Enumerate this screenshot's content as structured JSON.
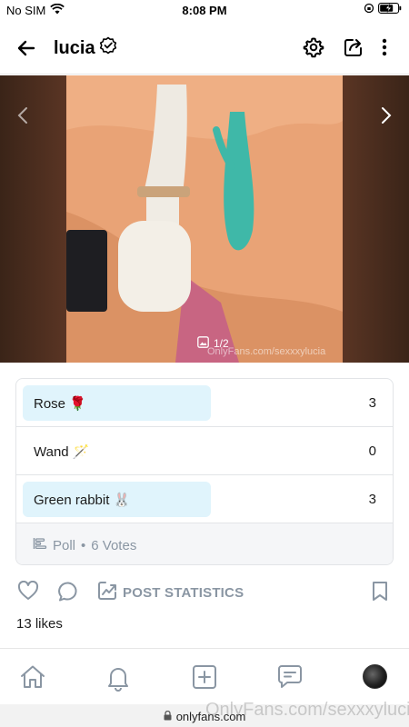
{
  "status_bar": {
    "carrier": "No SIM",
    "time": "8:08 PM"
  },
  "header": {
    "username": "lucia"
  },
  "media": {
    "counter": "1/2",
    "watermark": "OnlyFans.com/sexxxylucia"
  },
  "poll": {
    "options": [
      {
        "label": "Rose 🌹",
        "votes": "3",
        "share": 0.5
      },
      {
        "label": "Wand 🪄",
        "votes": "0",
        "share": 0
      },
      {
        "label": "Green rabbit 🐰",
        "votes": "3",
        "share": 0.5
      }
    ],
    "footer_label": "Poll",
    "separator": "•",
    "votes_text": "6 Votes"
  },
  "actions": {
    "stats_label": "POST STATISTICS"
  },
  "likes_text": "13 likes",
  "browser": {
    "url": "onlyfans.com",
    "watermark": "OnlyFans.com/sexxxylucia"
  },
  "colors": {
    "accent": "#00aff0",
    "poll_fill": "#e0f4fc",
    "muted": "#8a96a3"
  }
}
